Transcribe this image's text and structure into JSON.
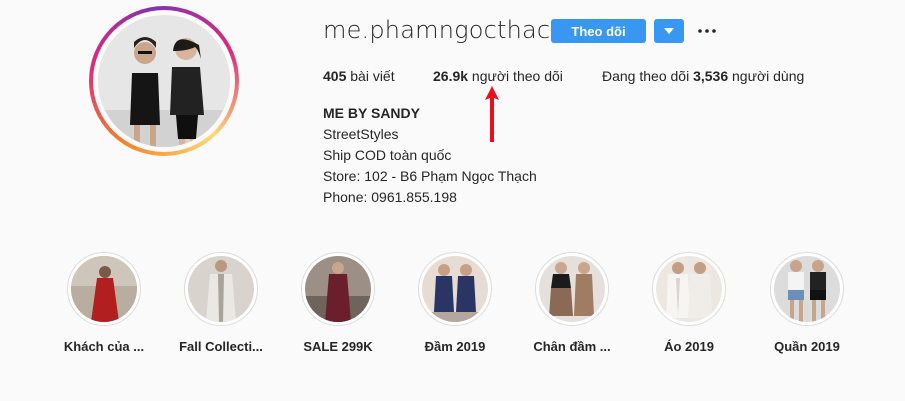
{
  "profile": {
    "username": "me.phamngocthach",
    "follow_label": "Theo dõi",
    "stats": {
      "posts_count": "405",
      "posts_label": " bài viết",
      "followers_count": "26.9k",
      "followers_label": " người theo dõi",
      "following_prefix": "Đang theo dõi ",
      "following_count": "3,536",
      "following_suffix": " người dùng"
    },
    "bio": {
      "name": "ME BY SANDY",
      "lines": [
        "StreetStyles",
        "Ship COD toàn quốc",
        "Store: 102 - B6 Phạm Ngọc Thạch",
        "Phone: 0961.855.198"
      ]
    }
  },
  "highlights": [
    {
      "label": "Khách của ..."
    },
    {
      "label": "Fall Collecti..."
    },
    {
      "label": "SALE 299K"
    },
    {
      "label": "Đầm 2019"
    },
    {
      "label": "Chân đầm ..."
    },
    {
      "label": "Áo 2019"
    },
    {
      "label": "Quần 2019"
    }
  ],
  "colors": {
    "accent": "#3897f0",
    "arrow": "#e8101e",
    "text": "#262626"
  },
  "icons": {
    "dropdown": "caret-down-icon",
    "more": "more-dots-icon",
    "arrow": "red-up-arrow-icon"
  }
}
